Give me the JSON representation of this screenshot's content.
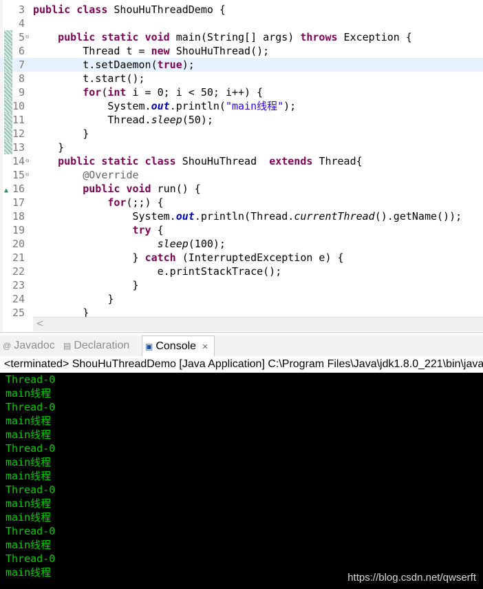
{
  "editor": {
    "lines": [
      {
        "n": "3",
        "t": "public class ShouHuThreadDemo {"
      },
      {
        "n": "4",
        "t": ""
      },
      {
        "n": "5",
        "t": "    public static void main(String[] args) throws Exception {"
      },
      {
        "n": "6",
        "t": "        Thread t = new ShouHuThread();"
      },
      {
        "n": "7",
        "t": "        t.setDaemon(true);"
      },
      {
        "n": "8",
        "t": "        t.start();"
      },
      {
        "n": "9",
        "t": "        for(int i = 0; i < 50; i++) {"
      },
      {
        "n": "10",
        "t": "            System.out.println(\"main线程\");"
      },
      {
        "n": "11",
        "t": "            Thread.sleep(50);"
      },
      {
        "n": "12",
        "t": "        }"
      },
      {
        "n": "13",
        "t": "    }"
      },
      {
        "n": "14",
        "t": "    public static class ShouHuThread  extends Thread{"
      },
      {
        "n": "15",
        "t": "        @Override"
      },
      {
        "n": "16",
        "t": "        public void run() {"
      },
      {
        "n": "17",
        "t": "            for(;;) {"
      },
      {
        "n": "18",
        "t": "                System.out.println(Thread.currentThread().getName());"
      },
      {
        "n": "19",
        "t": "                try {"
      },
      {
        "n": "20",
        "t": "                    sleep(100);"
      },
      {
        "n": "21",
        "t": "                } catch (InterruptedException e) {"
      },
      {
        "n": "22",
        "t": "                    e.printStackTrace();"
      },
      {
        "n": "23",
        "t": "                }"
      },
      {
        "n": "24",
        "t": "            }"
      },
      {
        "n": "25",
        "t": "        }"
      }
    ],
    "fold_icon": "collapse-minus-icon",
    "override_icon": "override-triangle-icon"
  },
  "tabs": [
    {
      "label": "Javadoc",
      "icon": "at-icon",
      "glyph": "@"
    },
    {
      "label": "Declaration",
      "icon": "declaration-icon",
      "glyph": "▤"
    },
    {
      "label": "Console",
      "icon": "console-icon",
      "glyph": "▣",
      "close": "✕"
    }
  ],
  "console": {
    "status": "<terminated> ShouHuThreadDemo [Java Application] C:\\Program Files\\Java\\jdk1.8.0_221\\bin\\javaw.exe",
    "output": [
      "Thread-0",
      "main线程",
      "Thread-0",
      "main线程",
      "main线程",
      "Thread-0",
      "main线程",
      "main线程",
      "Thread-0",
      "main线程",
      "main线程",
      "Thread-0",
      "main线程",
      "Thread-0",
      "main线程"
    ],
    "text_color": "#00d000",
    "background": "#000000"
  },
  "watermark": "https://blog.csdn.net/qwserft"
}
